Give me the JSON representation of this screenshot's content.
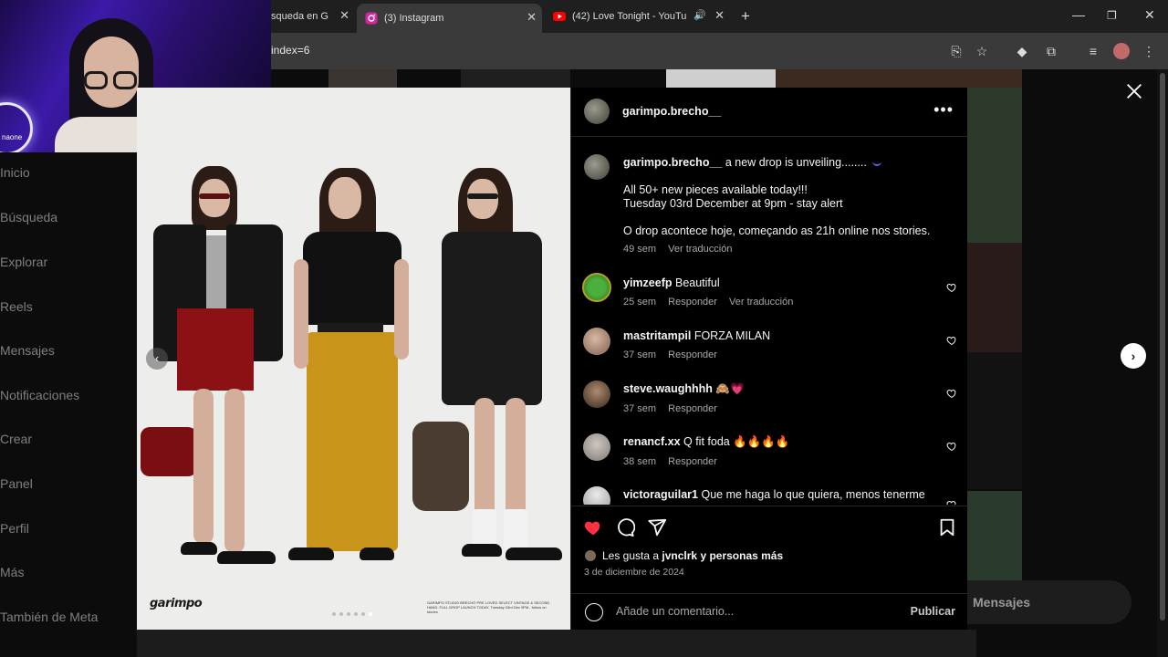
{
  "browser": {
    "tabs": [
      {
        "title": "squeda en G",
        "favicon_color": "#6b6b6b"
      },
      {
        "title": "(3) Instagram",
        "favicon_color": "#d6249f"
      },
      {
        "title": "(42) Love Tonight - YouTub",
        "favicon_color": "#ff0000"
      }
    ],
    "url": "index=6"
  },
  "webcam": {
    "ring_text": "naone"
  },
  "sidebar": {
    "items": [
      "Inicio",
      "Búsqueda",
      "Explorar",
      "Reels",
      "Mensajes",
      "Notificaciones",
      "Crear",
      "Panel",
      "Perfil",
      "Más",
      "También de Meta"
    ]
  },
  "messages_pill": {
    "label": "Mensajes"
  },
  "post": {
    "username": "garimpo.brecho__",
    "image": {
      "brand_left": "garimpo",
      "brand_right": "GARIMPO STUDIO BRECHÓ PRE LOVED SELECT VINTAGE & SECOND HAND. FULL DROP LAUNCH TODAY. Tuesday 03rd Dec 9PM - follow on stories",
      "dot_count": 6,
      "active_dot": 5
    },
    "caption": {
      "username": "garimpo.brecho__",
      "line1": "a new drop is unveiling........",
      "line2": "All 50+ new pieces available today!!!",
      "line3": "Tuesday 03rd December at 9pm - stay alert",
      "line4": "O drop acontece hoje, começando as 21h online nos stories.",
      "time": "49 sem",
      "translate": "Ver traducción"
    },
    "comments": [
      {
        "user": "yimzeefp",
        "text": "Beautiful",
        "time": "25 sem",
        "reply": "Responder",
        "translate": "Ver traducción",
        "avatar_color": "#3d8b37"
      },
      {
        "user": "mastritampil",
        "text": "FORZA MILAN",
        "time": "37 sem",
        "reply": "Responder",
        "translate": "",
        "avatar_color": "#b99a85"
      },
      {
        "user": "steve.waughhhh",
        "text": "🙈💗",
        "time": "37 sem",
        "reply": "Responder",
        "translate": "",
        "avatar_color": "#6a5747"
      },
      {
        "user": "renancf.xx",
        "text": "Q fit foda 🔥🔥🔥🔥",
        "time": "38 sem",
        "reply": "Responder",
        "translate": "",
        "avatar_color": "#8f8a86"
      },
      {
        "user": "victoraguilar1",
        "text": "Que me haga lo que quiera, menos tenerme",
        "time": "",
        "reply": "",
        "translate": "",
        "avatar_color": "#c8c8c8"
      }
    ],
    "likes": {
      "prefix": "Les gusta a",
      "user": "jvnclrk",
      "suffix": "y personas más"
    },
    "date": "3 de diciembre de 2024",
    "comment_placeholder": "Añade un comentario...",
    "publish_label": "Publicar"
  },
  "colors": {
    "like_red": "#ff3040",
    "panel_bg": "#000000"
  }
}
